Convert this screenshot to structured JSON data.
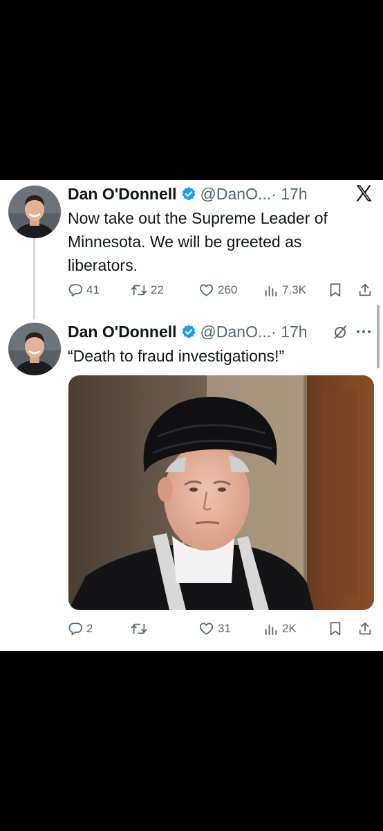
{
  "tweets": [
    {
      "author": "Dan O'Donnell",
      "handle": "@DanO...",
      "time": "· 17h",
      "text": "Now take out the Supreme Leader of Minnesota. We will be greeted as liberators.",
      "replies": "41",
      "retweets": "22",
      "likes": "260",
      "views": "7.3K"
    },
    {
      "author": "Dan O'Donnell",
      "handle": "@DanO...",
      "time": "· 17h",
      "text": "“Death to fraud investigations!”",
      "replies": "2",
      "retweets": "",
      "likes": "31",
      "views": "2K"
    }
  ],
  "icons": {
    "app_logo": "x-logo-icon",
    "verified": "verified-badge-icon",
    "grok": "grok-icon",
    "more": "more-options-icon",
    "reply": "reply-icon",
    "retweet": "retweet-icon",
    "like": "like-icon",
    "views": "views-icon",
    "bookmark": "bookmark-icon",
    "share": "share-icon"
  },
  "colors": {
    "verified_blue": "#1d9bf0",
    "text": "#0f1419",
    "secondary": "#536471",
    "background": "#ffffff",
    "letterbox": "#000000"
  }
}
